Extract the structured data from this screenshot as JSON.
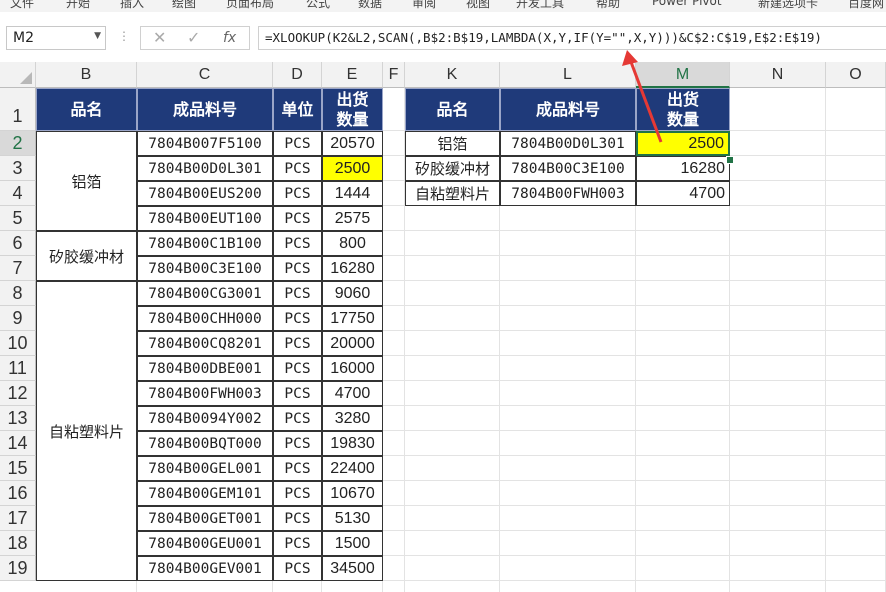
{
  "ribbon": [
    "文件",
    "开始",
    "插入",
    "绘图",
    "页面布局",
    "公式",
    "数据",
    "审阅",
    "视图",
    "开发工具",
    "帮助",
    "Power Pivot",
    "新建选项卡",
    "百度网"
  ],
  "namebox": "M2",
  "formula": "=XLOOKUP(K2&L2,SCAN(,B$2:B$19,LAMBDA(X,Y,IF(Y=\"\",X,Y)))&C$2:C$19,E$2:E$19)",
  "columns": {
    "B": "B",
    "C": "C",
    "D": "D",
    "E": "E",
    "F": "F",
    "K": "K",
    "L": "L",
    "M": "M",
    "N": "N",
    "O": "O"
  },
  "rows": [
    "1",
    "2",
    "3",
    "4",
    "5",
    "6",
    "7",
    "8",
    "9",
    "10",
    "11",
    "12",
    "13",
    "14",
    "15",
    "16",
    "17",
    "18",
    "19"
  ],
  "left_headers": [
    "品名",
    "成品料号",
    "单位",
    "出货\n数量"
  ],
  "groups": [
    {
      "name": "铝箔",
      "start": 0,
      "count": 4
    },
    {
      "name": "矽胶缓冲材",
      "start": 4,
      "count": 2
    },
    {
      "name": "自粘塑料片",
      "start": 6,
      "count": 12
    }
  ],
  "left_rows": [
    {
      "code": "7804B007F5100",
      "unit": "PCS",
      "qty": "20570"
    },
    {
      "code": "7804B00D0L301",
      "unit": "PCS",
      "qty": "2500"
    },
    {
      "code": "7804B00EUS200",
      "unit": "PCS",
      "qty": "1444"
    },
    {
      "code": "7804B00EUT100",
      "unit": "PCS",
      "qty": "2575"
    },
    {
      "code": "7804B00C1B100",
      "unit": "PCS",
      "qty": "800"
    },
    {
      "code": "7804B00C3E100",
      "unit": "PCS",
      "qty": "16280"
    },
    {
      "code": "7804B00CG3001",
      "unit": "PCS",
      "qty": "9060"
    },
    {
      "code": "7804B00CHH000",
      "unit": "PCS",
      "qty": "17750"
    },
    {
      "code": "7804B00CQ8201",
      "unit": "PCS",
      "qty": "20000"
    },
    {
      "code": "7804B00DBE001",
      "unit": "PCS",
      "qty": "16000"
    },
    {
      "code": "7804B00FWH003",
      "unit": "PCS",
      "qty": "4700"
    },
    {
      "code": "7804B0094Y002",
      "unit": "PCS",
      "qty": "3280"
    },
    {
      "code": "7804B00BQT000",
      "unit": "PCS",
      "qty": "19830"
    },
    {
      "code": "7804B00GEL001",
      "unit": "PCS",
      "qty": "22400"
    },
    {
      "code": "7804B00GEM101",
      "unit": "PCS",
      "qty": "10670"
    },
    {
      "code": "7804B00GET001",
      "unit": "PCS",
      "qty": "5130"
    },
    {
      "code": "7804B00GEU001",
      "unit": "PCS",
      "qty": "1500"
    },
    {
      "code": "7804B00GEV001",
      "unit": "PCS",
      "qty": "34500"
    }
  ],
  "right_headers": [
    "品名",
    "成品料号",
    "出货\n数量"
  ],
  "right_rows": [
    {
      "name": "铝箔",
      "code": "7804B00D0L301",
      "qty": "2500"
    },
    {
      "name": "矽胶缓冲材",
      "code": "7804B00C3E100",
      "qty": "16280"
    },
    {
      "name": "自粘塑料片",
      "code": "7804B00FWH003",
      "qty": "4700"
    }
  ],
  "colors": {
    "header_bg": "#1f3a7a",
    "highlight": "#ffff00",
    "arrow": "#e53935"
  }
}
